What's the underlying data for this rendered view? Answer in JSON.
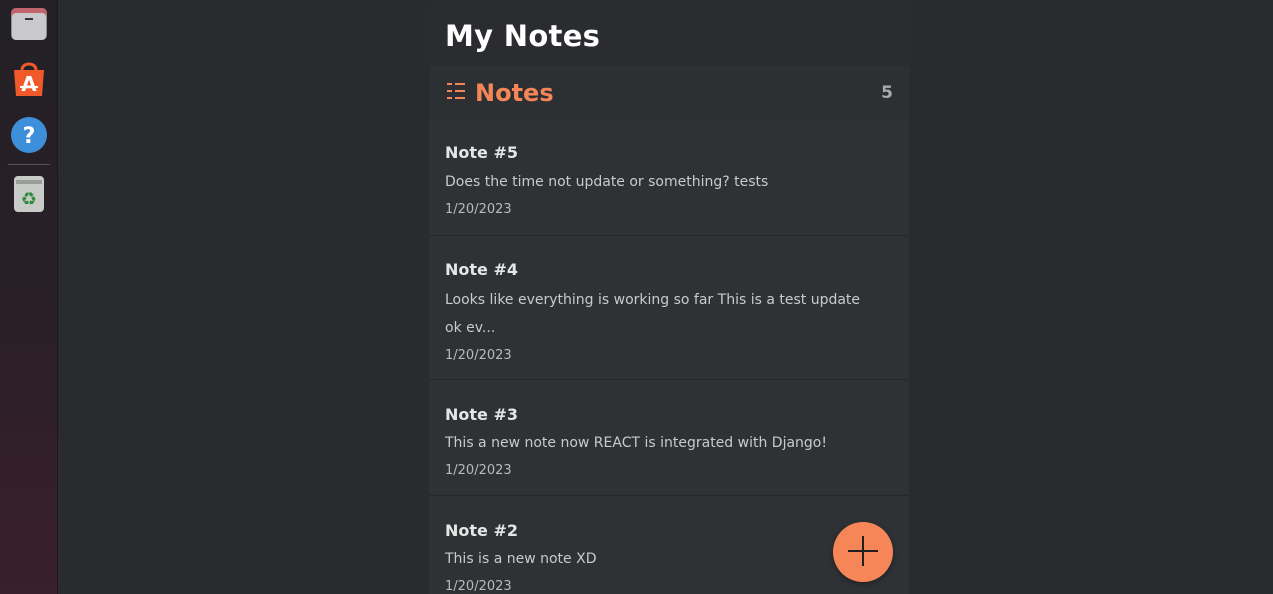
{
  "dock": {
    "items": [
      {
        "name": "Files",
        "icon": "file-cabinet-icon"
      },
      {
        "name": "App Center",
        "icon": "app-store-icon"
      },
      {
        "name": "Help",
        "icon": "help-icon"
      },
      {
        "name": "Trash",
        "icon": "trash-icon"
      }
    ]
  },
  "app": {
    "title": "My Notes",
    "notes_header": {
      "label": "Notes",
      "count": "5",
      "icon": "list-icon"
    },
    "notes": [
      {
        "title": "Note #5",
        "body": "Does the time not update or something? tests",
        "date": "1/20/2023"
      },
      {
        "title": "Note #4",
        "body": "Looks like everything is working so far This is a test update ok ev...",
        "date": "1/20/2023"
      },
      {
        "title": "Note #3",
        "body": "This a new note now REACT is integrated with Django!",
        "date": "1/20/2023"
      },
      {
        "title": "Note #2",
        "body": "This is a new note XD",
        "date": "1/20/2023"
      }
    ],
    "add_button": {
      "icon": "plus-icon"
    }
  },
  "colors": {
    "accent": "#f68657",
    "background": "#2a2b2e",
    "panel": "#2e3235"
  }
}
